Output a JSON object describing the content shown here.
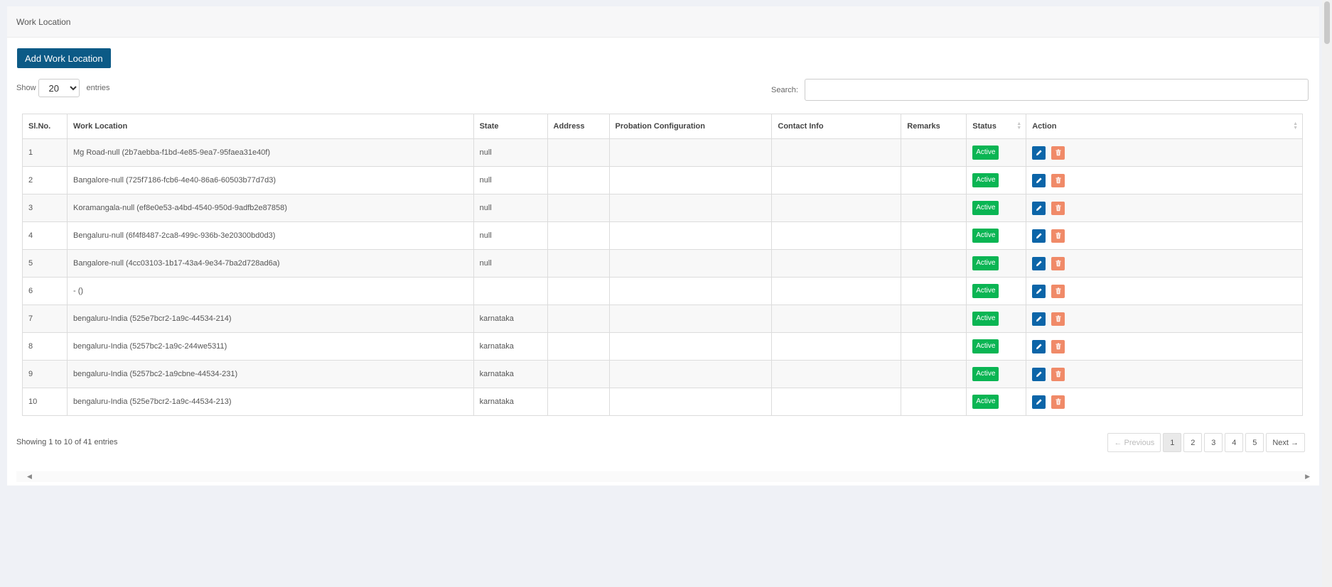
{
  "header": {
    "title": "Work Location"
  },
  "toolbar": {
    "add_label": "Add Work Location",
    "show_label": "Show",
    "entries_label": "entries",
    "page_size": "20",
    "search_label": "Search:"
  },
  "table": {
    "columns": [
      "Sl.No.",
      "Work Location",
      "State",
      "Address",
      "Probation Configuration",
      "Contact Info",
      "Remarks",
      "Status",
      "Action"
    ],
    "rows": [
      {
        "sl": "1",
        "location": "Mg Road-null (2b7aebba-f1bd-4e85-9ea7-95faea31e40f)",
        "state": "null",
        "address": "",
        "probation": "",
        "contact": "",
        "remarks": "",
        "status": "Active"
      },
      {
        "sl": "2",
        "location": "Bangalore-null (725f7186-fcb6-4e40-86a6-60503b77d7d3)",
        "state": "null",
        "address": "",
        "probation": "",
        "contact": "",
        "remarks": "",
        "status": "Active"
      },
      {
        "sl": "3",
        "location": "Koramangala-null (ef8e0e53-a4bd-4540-950d-9adfb2e87858)",
        "state": "null",
        "address": "",
        "probation": "",
        "contact": "",
        "remarks": "",
        "status": "Active"
      },
      {
        "sl": "4",
        "location": "Bengaluru-null (6f4f8487-2ca8-499c-936b-3e20300bd0d3)",
        "state": "null",
        "address": "",
        "probation": "",
        "contact": "",
        "remarks": "",
        "status": "Active"
      },
      {
        "sl": "5",
        "location": "Bangalore-null (4cc03103-1b17-43a4-9e34-7ba2d728ad6a)",
        "state": "null",
        "address": "",
        "probation": "",
        "contact": "",
        "remarks": "",
        "status": "Active"
      },
      {
        "sl": "6",
        "location": "- ()",
        "state": "",
        "address": "",
        "probation": "",
        "contact": "",
        "remarks": "",
        "status": "Active"
      },
      {
        "sl": "7",
        "location": "bengaluru-India (525e7bcr2-1a9c-44534-214)",
        "state": "karnataka",
        "address": "",
        "probation": "",
        "contact": "",
        "remarks": "",
        "status": "Active"
      },
      {
        "sl": "8",
        "location": "bengaluru-India (5257bc2-1a9c-244we5311)",
        "state": "karnataka",
        "address": "",
        "probation": "",
        "contact": "",
        "remarks": "",
        "status": "Active"
      },
      {
        "sl": "9",
        "location": "bengaluru-India (5257bc2-1a9cbne-44534-231)",
        "state": "karnataka",
        "address": "",
        "probation": "",
        "contact": "",
        "remarks": "",
        "status": "Active"
      },
      {
        "sl": "10",
        "location": "bengaluru-India (525e7bcr2-1a9c-44534-213)",
        "state": "karnataka",
        "address": "",
        "probation": "",
        "contact": "",
        "remarks": "",
        "status": "Active"
      }
    ]
  },
  "footer": {
    "info": "Showing 1 to 10 of 41 entries",
    "previous": "← Previous",
    "next": "Next →",
    "pages": [
      "1",
      "2",
      "3",
      "4",
      "5"
    ],
    "current_page": "1"
  },
  "colors": {
    "primary": "#0c5a86",
    "active_badge": "#0ab553",
    "edit": "#0c65a8",
    "delete": "#f08a68"
  },
  "icons": {
    "edit": "pencil-icon",
    "delete": "trash-icon"
  }
}
